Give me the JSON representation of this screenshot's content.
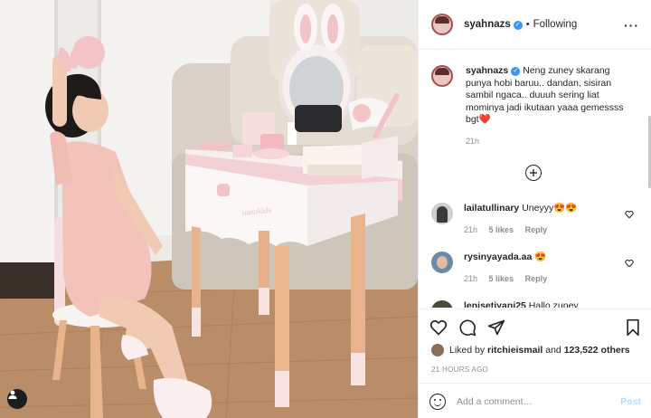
{
  "header": {
    "username": "syahnazs",
    "following_label": "Following",
    "verified_mark": "✓",
    "more_icon": "more-options-icon"
  },
  "caption": {
    "username": "syahnazs",
    "text": "Neng zuney skarang punya hobi baruu.. dandan, sisiran sambil ngaca.. duuuh sering liat mominya jadi ikutaan yaaa gemessss bgt",
    "emoji": "❤️",
    "time": "21h"
  },
  "comments": [
    {
      "username": "lailatullinary",
      "text": "Uneyyy",
      "emoji": "😍😍",
      "time": "21h",
      "likes": "5 likes",
      "reply": "Reply"
    },
    {
      "username": "rysinyayada.aa",
      "text": "",
      "emoji": "😍",
      "time": "21h",
      "likes": "5 likes",
      "reply": "Reply"
    },
    {
      "username": "lenisetiyani25",
      "text": "Hallo zuney",
      "emoji": "",
      "time": "",
      "likes": "",
      "reply": ""
    }
  ],
  "actions": {
    "liked_prefix": "Liked by",
    "liked_user": "ritchieismail",
    "liked_and": "and",
    "liked_others": "123,522 others",
    "timestamp": "21 HOURS AGO"
  },
  "add_comment": {
    "placeholder": "Add a comment…",
    "post_label": "Post"
  },
  "photo": {
    "toy_brand": "nanokids"
  },
  "colors": {
    "verified": "#3897f0",
    "post_button": "#b2dffc",
    "muted": "#8e8e8e"
  }
}
